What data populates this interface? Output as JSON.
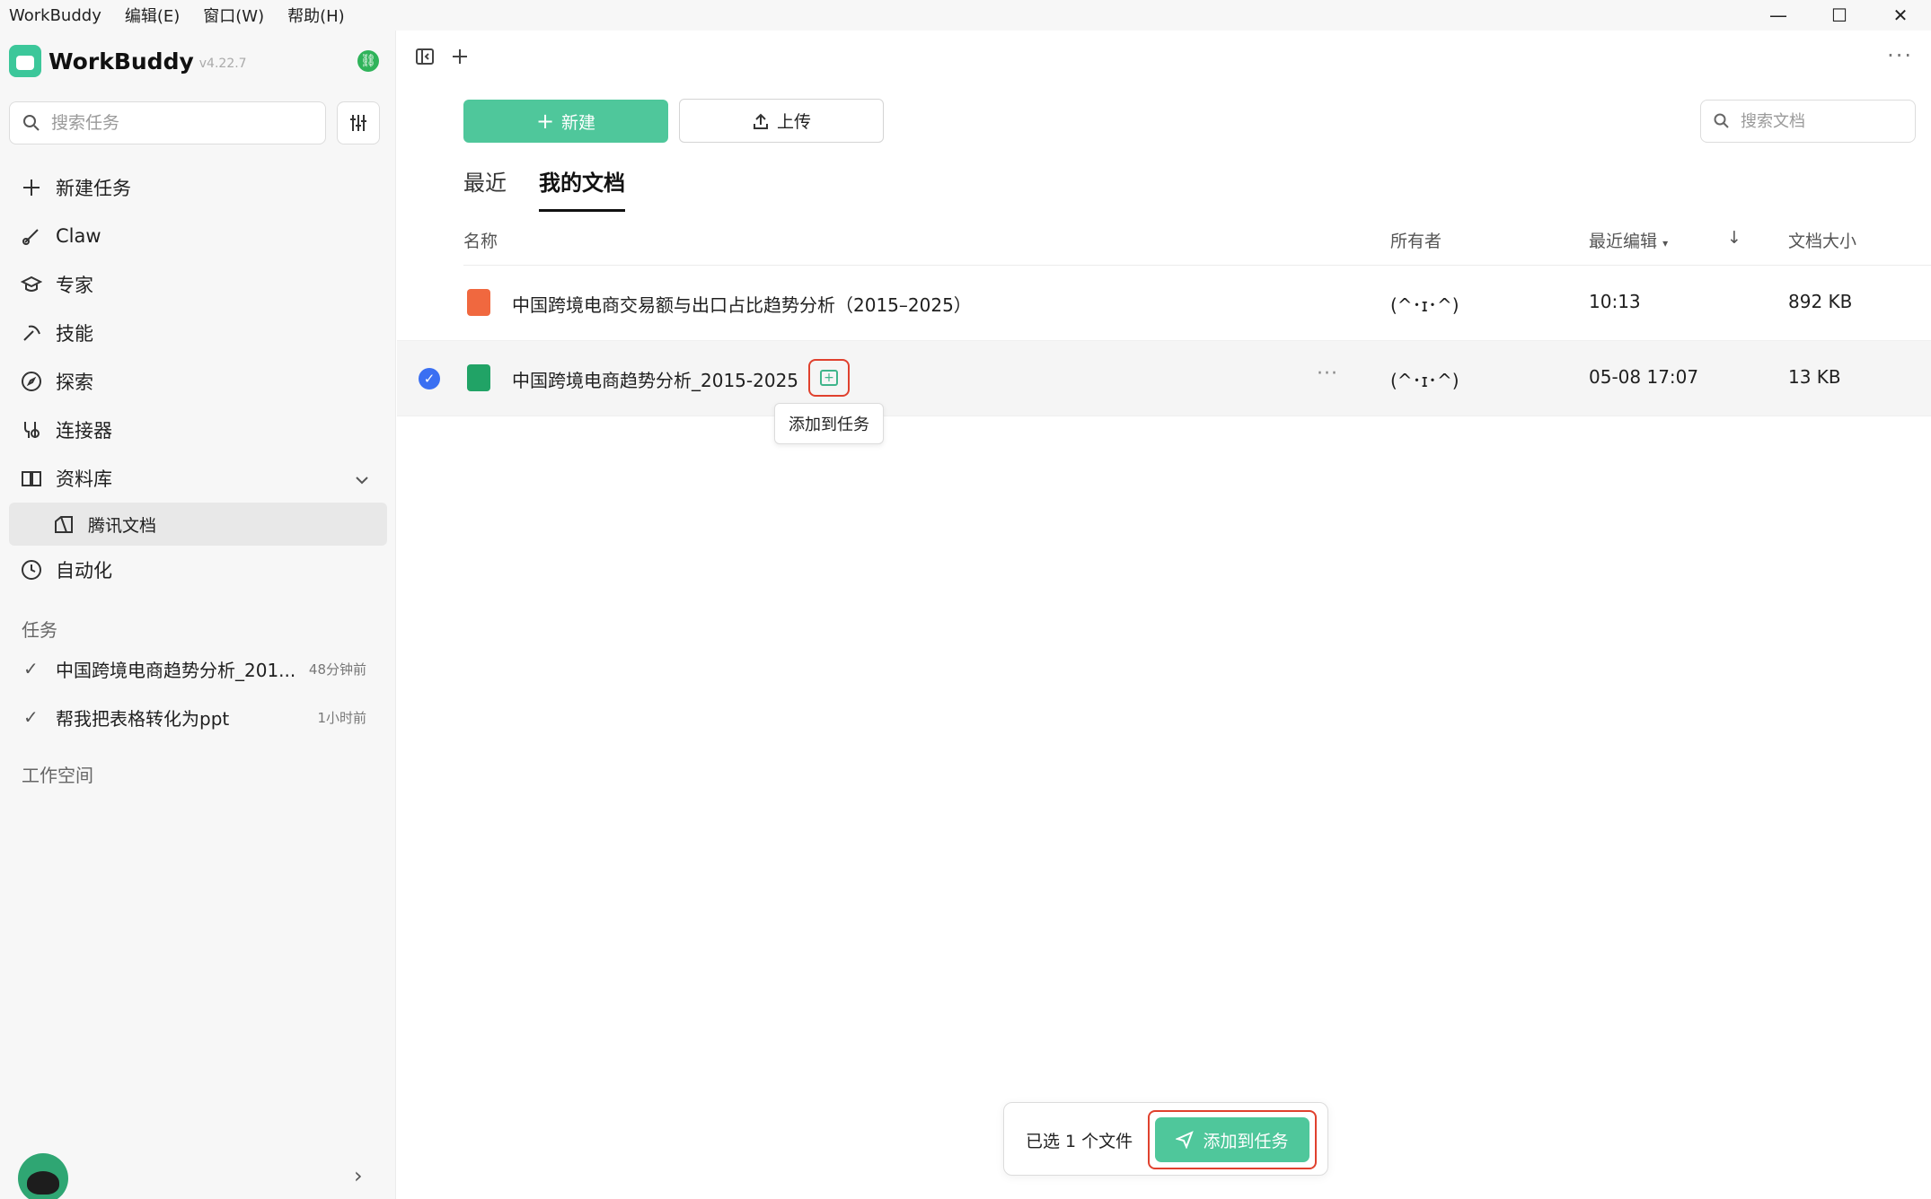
{
  "menubar": {
    "app_name": "WorkBuddy",
    "items": [
      "编辑(E)",
      "窗口(W)",
      "帮助(H)"
    ]
  },
  "window_controls": {
    "minimize": "—",
    "maximize": "☐",
    "close": "✕"
  },
  "sidebar": {
    "brand": "WorkBuddy",
    "version": "v4.22.7",
    "search_placeholder": "搜索任务",
    "nav": [
      {
        "label": "新建任务",
        "icon": "plus-icon"
      },
      {
        "label": "Claw",
        "icon": "brush-icon"
      },
      {
        "label": "专家",
        "icon": "graduation-cap-icon"
      },
      {
        "label": "技能",
        "icon": "pickaxe-icon"
      },
      {
        "label": "探索",
        "icon": "compass-icon"
      },
      {
        "label": "连接器",
        "icon": "connector-icon"
      },
      {
        "label": "资料库",
        "icon": "book-icon"
      },
      {
        "label": "腾讯文档",
        "icon": "tencent-docs-icon"
      },
      {
        "label": "自动化",
        "icon": "clock-icon"
      }
    ],
    "tasks_label": "任务",
    "tasks": [
      {
        "title": "中国跨境电商趋势分析_201...",
        "time": "48分钟前"
      },
      {
        "title": "帮我把表格转化为ppt",
        "time": "1小时前"
      }
    ],
    "workspace_label": "工作空间"
  },
  "main": {
    "new_button": "新建",
    "upload_button": "上传",
    "search_placeholder": "搜索文档",
    "tabs": [
      "最近",
      "我的文档"
    ],
    "active_tab": "我的文档",
    "columns": {
      "name": "名称",
      "owner": "所有者",
      "last_edit": "最近编辑",
      "size": "文档大小"
    },
    "rows": [
      {
        "name": "中国跨境电商交易额与出口占比趋势分析（2015–2025）",
        "owner": "(^･ɪ･^)",
        "edited": "10:13",
        "size": "892 KB",
        "type": "slides"
      },
      {
        "name": "中国跨境电商趋势分析_2015-2025",
        "owner": "(^･ɪ･^)",
        "edited": "05-08 17:07",
        "size": "13 KB",
        "type": "sheet",
        "selected": true
      }
    ],
    "tooltip": "添加到任务",
    "bottom_bar": {
      "selected_text": "已选 1 个文件",
      "add_button": "添加到任务"
    }
  }
}
